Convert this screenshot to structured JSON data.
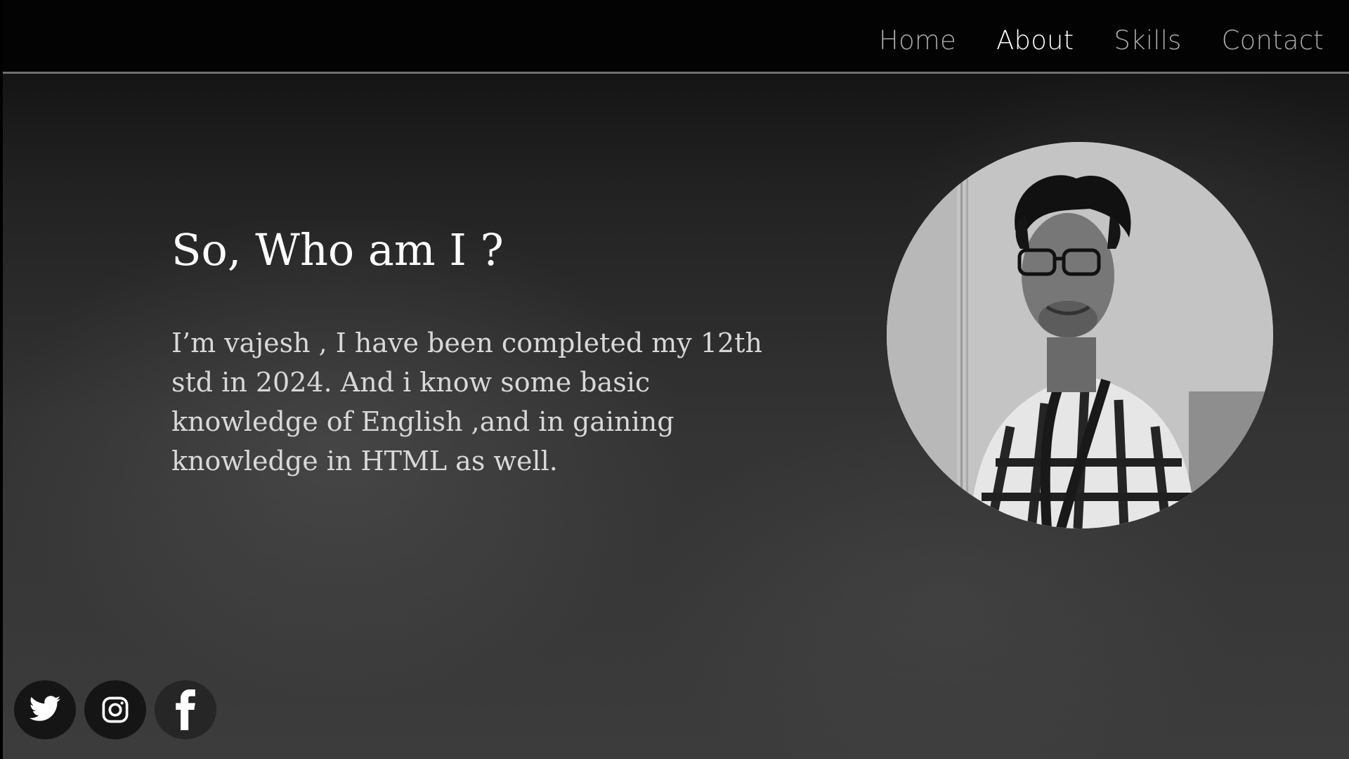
{
  "nav": {
    "items": [
      {
        "label": "Home",
        "active": false
      },
      {
        "label": "About",
        "active": true
      },
      {
        "label": "Skills",
        "active": false
      },
      {
        "label": "Contact",
        "active": false
      }
    ]
  },
  "about": {
    "title": "So, Who am I ?",
    "text": "I’m vajesh , I have been completed my 12th std in 2024. And i know some basic knowledge of English ,and in gaining knowledge in HTML as well."
  },
  "portrait": {
    "icon": "profile-photo"
  },
  "social": [
    {
      "name": "twitter",
      "icon": "twitter-icon"
    },
    {
      "name": "instagram",
      "icon": "instagram-icon"
    },
    {
      "name": "facebook",
      "icon": "facebook-icon"
    }
  ],
  "colors": {
    "background": "#333333",
    "navbar": "#030303",
    "nav_text": "#a9a9a9",
    "nav_active": "#ffffff",
    "heading": "#ffffff",
    "body_text": "#d8d8d8"
  }
}
